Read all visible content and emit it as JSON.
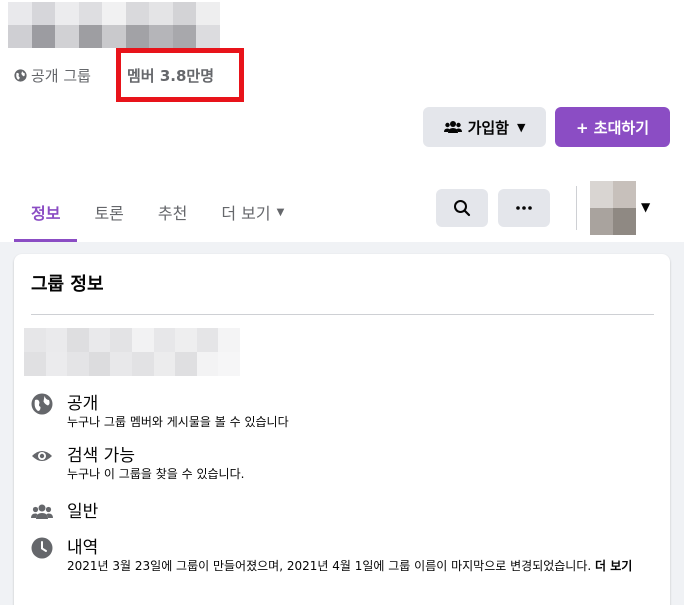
{
  "group": {
    "privacy_label": "공개 그룹",
    "members_label": "멤버 3.8만명"
  },
  "actions": {
    "joined_label": "가입함",
    "invite_label": "+ 초대하기"
  },
  "tabs": [
    {
      "label": "정보",
      "active": true
    },
    {
      "label": "토론",
      "active": false
    },
    {
      "label": "추천",
      "active": false
    },
    {
      "label": "더 보기",
      "active": false
    }
  ],
  "about": {
    "title": "그룹 정보",
    "items": [
      {
        "icon": "globe-icon",
        "title": "공개",
        "desc": "누구나 그룹 멤버와 게시물을 볼 수 있습니다"
      },
      {
        "icon": "eye-icon",
        "title": "검색 가능",
        "desc": "누구나 이 그룹을 찾을 수 있습니다."
      },
      {
        "icon": "people-icon",
        "title": "일반",
        "desc": ""
      },
      {
        "icon": "clock-icon",
        "title": "내역",
        "desc": "2021년 3월 23일에 그룹이 만들어졌으며, 2021년 4월 1일에 그룹 이름이 마지막으로 변경되었습니다.",
        "more_label": "더 보기"
      }
    ]
  },
  "colors": {
    "accent": "#8b4dc4",
    "highlight_box": "#e8131a",
    "secondary_text": "#65676b",
    "button_gray": "#e4e6eb",
    "page_bg": "#f0f2f5"
  }
}
